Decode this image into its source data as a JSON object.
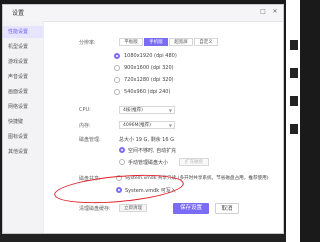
{
  "dialog": {
    "title": "设置"
  },
  "window_controls": {
    "maximize": "□",
    "close": "✕"
  },
  "sidebar": {
    "items": [
      "性能设置",
      "机型设置",
      "游戏设置",
      "声音设置",
      "画面设置",
      "网络设置",
      "快捷键",
      "图标设置",
      "其他设置"
    ],
    "active_index": 0
  },
  "resolution": {
    "label": "分辨率:",
    "tabs": [
      "平板版",
      "手机版",
      "超宽屏",
      "自定义"
    ],
    "active_tab": 1,
    "options": [
      "1080x1920 (dpi 480)",
      "900x1600 (dpi 320)",
      "720x1280 (dpi 320)",
      "540x960 (dpi 240)"
    ],
    "selected_index": 0
  },
  "cpu": {
    "label": "CPU:",
    "value": "4核(推荐)"
  },
  "memory": {
    "label": "内存:",
    "value": "4096M(推荐)"
  },
  "disk": {
    "label": "磁盘管理:",
    "summary": "总大小 19 G, 剩余 16 G",
    "options": [
      "空间不够时, 自动扩充",
      "手动管理磁盘大小"
    ],
    "selected_index": 0,
    "expand_button": "扩充磁盘"
  },
  "disk_share": {
    "label": "磁盘共享:",
    "options": [
      "System.vmdk 共享只读 (多开时共享系统，节省磁盘占用，推荐使用)",
      "System.vmdk 可写入"
    ],
    "selected_index": 1
  },
  "backup": {
    "label": "清理磁盘缓存:",
    "button": "立即清理"
  },
  "footer": {
    "save": "保存设置",
    "cancel": "取消"
  },
  "colors": {
    "accent": "#7b6cf6",
    "annotation": "#e0202a"
  }
}
